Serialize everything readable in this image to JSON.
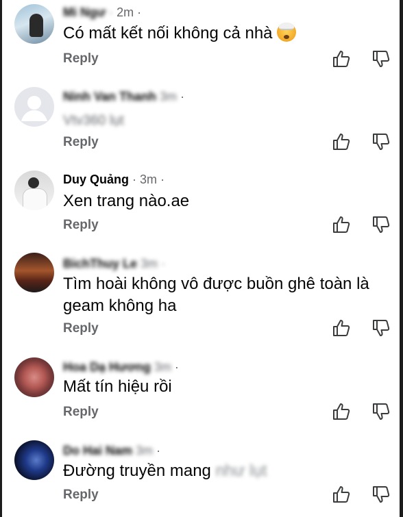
{
  "comments": [
    {
      "name": "Mi Ngư",
      "time": "2m",
      "text": "Có mất kết nối không cả nhà",
      "reply": "Reply",
      "emoji": "exploding-head"
    },
    {
      "name": "Ninh Van Thanh",
      "time": "3m",
      "text": "Vtv360 lụt",
      "reply": "Reply"
    },
    {
      "name": "Duy Quảng",
      "time": "3m",
      "text": "Xen trang nào.ae",
      "reply": "Reply"
    },
    {
      "name": "BichThuy Le",
      "time": "3m",
      "text": "Tìm hoài không vô được buồn ghê toàn là geam không ha",
      "reply": "Reply"
    },
    {
      "name": "Hoa Dạ Hương",
      "time": "3m",
      "text": "Mất tín hiệu rồi",
      "reply": "Reply"
    },
    {
      "name": "Do Hai Nam",
      "time": "3m",
      "text": "Đường truyền mang",
      "blurred_tail": "như lụt",
      "reply": "Reply"
    }
  ],
  "separator": "·",
  "icons": {
    "like": "thumbs-up-icon",
    "dislike": "thumbs-down-icon"
  }
}
